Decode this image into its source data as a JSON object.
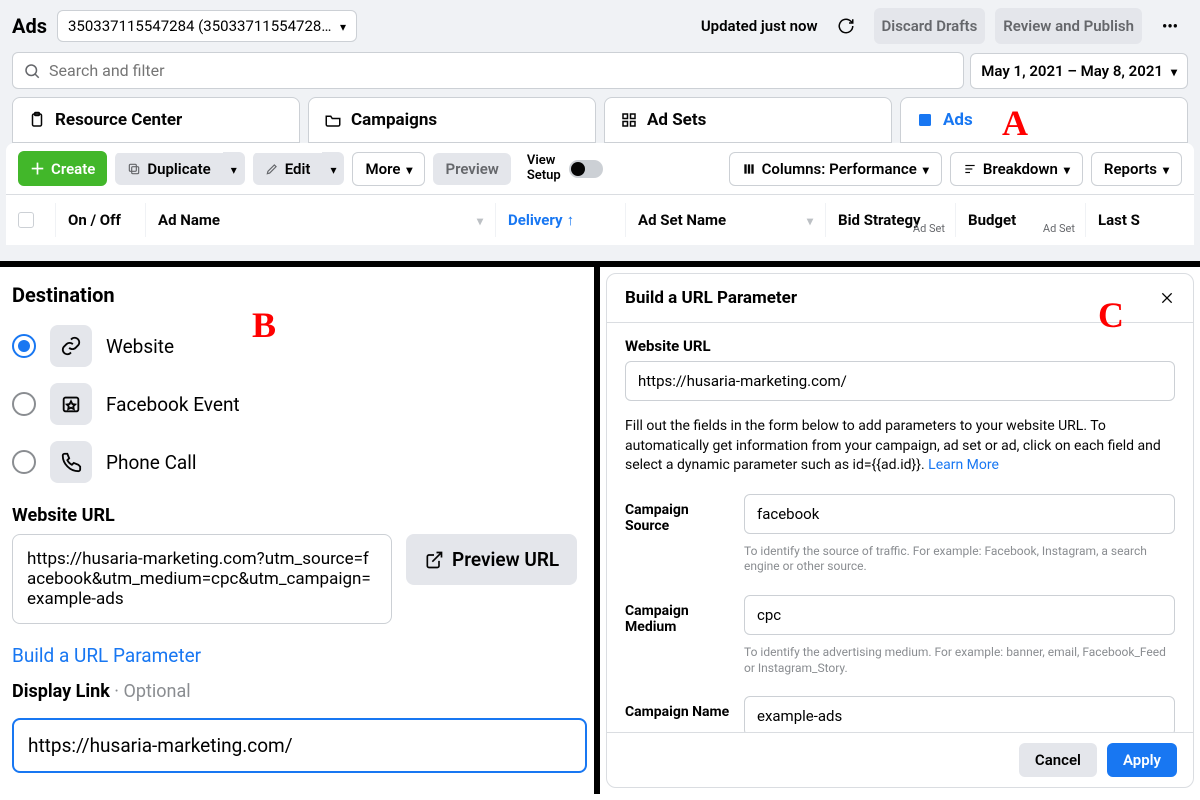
{
  "header": {
    "title": "Ads",
    "account": "350337115547284 (35033711554728…",
    "updated": "Updated just now",
    "discard": "Discard Drafts",
    "review": "Review and Publish",
    "search_placeholder": "Search and filter",
    "date_range": "May 1, 2021 – May 8, 2021"
  },
  "tabs": {
    "resource": "Resource Center",
    "campaigns": "Campaigns",
    "adsets": "Ad Sets",
    "ads": "Ads"
  },
  "toolbar": {
    "create": "Create",
    "duplicate": "Duplicate",
    "edit": "Edit",
    "more": "More",
    "preview": "Preview",
    "view_setup1": "View",
    "view_setup2": "Setup",
    "columns": "Columns: Performance",
    "breakdown": "Breakdown",
    "reports": "Reports"
  },
  "table": {
    "onoff": "On / Off",
    "adname": "Ad Name",
    "delivery": "Delivery",
    "adset": "Ad Set Name",
    "bid": "Bid Strategy",
    "budget": "Budget",
    "last": "Last S",
    "sub": "Ad Set"
  },
  "destination": {
    "title": "Destination",
    "website": "Website",
    "fbevent": "Facebook Event",
    "phone": "Phone Call",
    "url_label": "Website URL",
    "url_value": "https://husaria-marketing.com?utm_source=facebook&utm_medium=cpc&utm_campaign=example-ads",
    "preview": "Preview URL",
    "build_link": "Build a URL Parameter",
    "display_label": "Display Link",
    "optional": " · Optional",
    "display_value": "https://husaria-marketing.com/"
  },
  "modal": {
    "title": "Build a URL Parameter",
    "url_label": "Website URL",
    "url_value": "https://husaria-marketing.com/",
    "help": "Fill out the fields in the form below to add parameters to your website URL. To automatically get information from your campaign, ad set or ad, click on each field and select a dynamic parameter such as id={{ad.id}}. ",
    "learn": "Learn More",
    "src_label": "Campaign Source",
    "src_value": "facebook",
    "src_hint": "To identify the source of traffic. For example: Facebook, Instagram, a search engine or other source.",
    "med_label": "Campaign Medium",
    "med_value": "cpc",
    "med_hint": "To identify the advertising medium. For example: banner, email, Facebook_Feed or Instagram_Story.",
    "name_label": "Campaign Name",
    "name_value": "example-ads",
    "cancel": "Cancel",
    "apply": "Apply"
  },
  "markers": {
    "a": "A",
    "b": "B",
    "c": "C"
  }
}
